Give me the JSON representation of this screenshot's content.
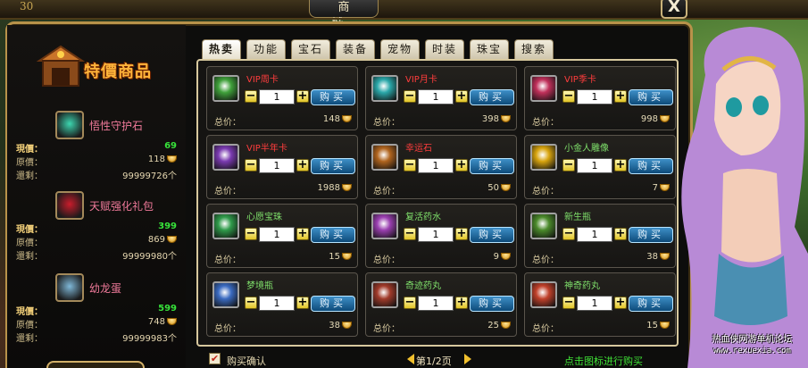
{
  "window": {
    "title": "商 城",
    "close_label": "X",
    "corner_glyph": "30"
  },
  "promo": {
    "banner_text": "特價商品",
    "labels": {
      "now": "現價：",
      "orig": "原價：",
      "left": "還剩："
    },
    "items": [
      {
        "name": "悟性守护石",
        "now": "69",
        "orig": "118",
        "left": "99999726个",
        "icon": "jade-orb-icon",
        "color": "#f07a9a"
      },
      {
        "name": "天赋强化礼包",
        "now": "399",
        "orig": "869",
        "left": "99999980个",
        "icon": "gift-box-icon",
        "color": "#f07a9a"
      },
      {
        "name": "幼龙蛋",
        "now": "599",
        "orig": "748",
        "left": "99999983个",
        "icon": "dragon-egg-icon",
        "color": "#f07a9a"
      }
    ]
  },
  "tabs": [
    {
      "label": "热卖",
      "active": true
    },
    {
      "label": "功能",
      "active": false
    },
    {
      "label": "宝石",
      "active": false
    },
    {
      "label": "装备",
      "active": false
    },
    {
      "label": "宠物",
      "active": false
    },
    {
      "label": "时装",
      "active": false
    },
    {
      "label": "珠宝",
      "active": false
    },
    {
      "label": "搜索",
      "active": false
    }
  ],
  "grid": {
    "total_label": "总价：",
    "buy_label": "购买",
    "items": [
      {
        "name": "VIP周卡",
        "qty": "1",
        "total": "148",
        "icon": "vip-week-card-icon",
        "name_color": "red",
        "icon_color": "#3fa03a"
      },
      {
        "name": "VIP月卡",
        "qty": "1",
        "total": "398",
        "icon": "vip-month-card-icon",
        "name_color": "red",
        "icon_color": "#2aa7a9"
      },
      {
        "name": "VIP季卡",
        "qty": "1",
        "total": "998",
        "icon": "vip-season-card-icon",
        "name_color": "red",
        "icon_color": "#c0305a"
      },
      {
        "name": "VIP半年卡",
        "qty": "1",
        "total": "1988",
        "icon": "vip-halfyear-card-icon",
        "name_color": "red",
        "icon_color": "#7a3ab0"
      },
      {
        "name": "幸运石",
        "qty": "1",
        "total": "50",
        "icon": "lucky-stone-icon",
        "name_color": "red",
        "icon_color": "#b0641e"
      },
      {
        "name": "小金人雕像",
        "qty": "1",
        "total": "7",
        "icon": "gold-statue-icon",
        "name_color": "green",
        "icon_color": "#d8a40e"
      },
      {
        "name": "心愿宝珠",
        "qty": "1",
        "total": "15",
        "icon": "wish-pearl-icon",
        "name_color": "green",
        "icon_color": "#2f9a4a"
      },
      {
        "name": "复活药水",
        "qty": "1",
        "total": "9",
        "icon": "revive-potion-icon",
        "name_color": "green",
        "icon_color": "#9a3fb0"
      },
      {
        "name": "新生瓶",
        "qty": "1",
        "total": "38",
        "icon": "rebirth-bottle-icon",
        "name_color": "green",
        "icon_color": "#4a8a2a"
      },
      {
        "name": "梦境瓶",
        "qty": "1",
        "total": "38",
        "icon": "dream-bottle-icon",
        "name_color": "green",
        "icon_color": "#3a6ac0"
      },
      {
        "name": "奇迹药丸",
        "qty": "1",
        "total": "25",
        "icon": "miracle-pill-icon",
        "name_color": "green",
        "icon_color": "#a03a2a"
      },
      {
        "name": "神奇药丸",
        "qty": "1",
        "total": "15",
        "icon": "magic-pill-icon",
        "name_color": "green",
        "icon_color": "#c0402a"
      }
    ]
  },
  "footer": {
    "confirm_label": "购买确认",
    "confirm_checked": true,
    "check_glyph": "✔",
    "page_text": "第1/2页",
    "hint": "点击图标进行购买"
  },
  "watermark": {
    "line1": "热血侠网游单机论坛",
    "line2": "www.rexuexia.com"
  }
}
